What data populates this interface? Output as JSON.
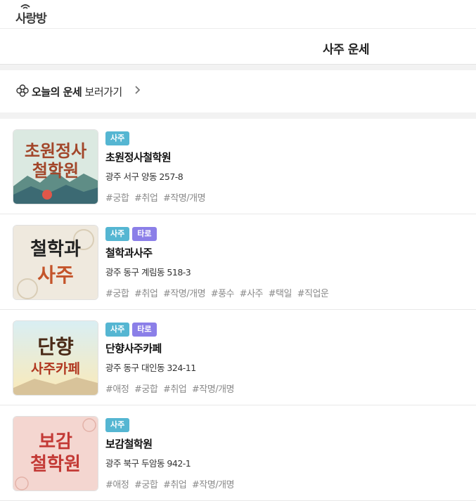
{
  "app": {
    "logo_text": "사랑방"
  },
  "header": {
    "title": "사주 운세"
  },
  "banner": {
    "bold": "오늘의 운세",
    "rest": "보러가기"
  },
  "colors": {
    "saju_tag": "#55b6d2",
    "taro_tag": "#8b7fe8"
  },
  "items": [
    {
      "thumb_lines": [
        "초원정사",
        "철학원"
      ],
      "tags": [
        "사주"
      ],
      "name": "초원정사철학원",
      "address": "광주 서구 양동 257-8",
      "hashtags": [
        "#궁합",
        "#취업",
        "#작명/개명"
      ]
    },
    {
      "thumb_lines": [
        "철학과",
        "사주"
      ],
      "tags": [
        "사주",
        "타로"
      ],
      "name": "철학과사주",
      "address": "광주 동구 계림동 518-3",
      "hashtags": [
        "#궁합",
        "#취업",
        "#작명/개명",
        "#풍수",
        "#사주",
        "#택일",
        "#직업운"
      ]
    },
    {
      "thumb_lines": [
        "단향",
        "사주카페"
      ],
      "tags": [
        "사주",
        "타로"
      ],
      "name": "단향사주카페",
      "address": "광주 동구 대인동 324-11",
      "hashtags": [
        "#애정",
        "#궁합",
        "#취업",
        "#작명/개명"
      ]
    },
    {
      "thumb_lines": [
        "보감",
        "철학원"
      ],
      "tags": [
        "사주"
      ],
      "name": "보감철학원",
      "address": "광주 북구 두암동 942-1",
      "hashtags": [
        "#애정",
        "#궁합",
        "#취업",
        "#작명/개명"
      ]
    }
  ]
}
